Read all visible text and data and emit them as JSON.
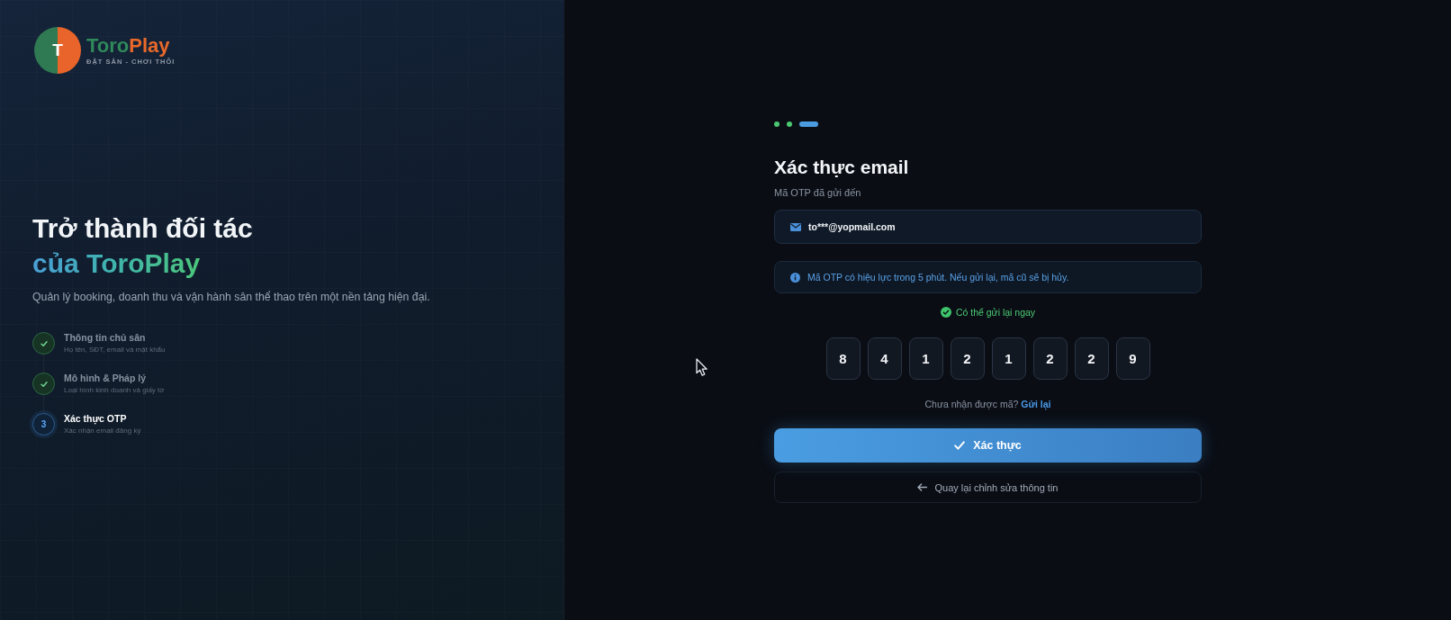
{
  "brand": {
    "logo_letter": "T",
    "name_parts": [
      {
        "text": "Toro",
        "color": "#2f8a5a"
      },
      {
        "text": "Play",
        "color": "#e8692a"
      }
    ],
    "tagline": "ĐẶT SÂN - CHƠI THÔI"
  },
  "hero": {
    "title_line_1": "Trở thành đối tác",
    "title_line_2": "của ToroPlay",
    "subtitle": "Quản lý booking, doanh thu và vận hành sân thể thao trên một nền tảng hiện đại."
  },
  "steps": [
    {
      "title": "Thông tin chủ sân",
      "description": "Họ tên, SĐT, email và mật khẩu",
      "completed": true,
      "selected": false
    },
    {
      "title": "Mô hình & Pháp lý",
      "description": "Loại hình kinh doanh và giấy tờ",
      "completed": true,
      "selected": false
    },
    {
      "number": "3",
      "title": "Xác thực OTP",
      "description": "Xác nhận email đăng ký",
      "completed": false,
      "selected": true
    }
  ],
  "form": {
    "progress": [
      {
        "completed": true,
        "selected": false
      },
      {
        "completed": true,
        "selected": false
      },
      {
        "completed": false,
        "selected": true
      }
    ],
    "title": "Xác thực email",
    "subtitle": "Mã OTP đã gửi đến",
    "email": "to***@yopmail.com",
    "info_note": "Mã OTP có hiệu lực trong 5 phút. Nếu gửi lại, mã cũ sẽ bị hủy.",
    "resend_status": "Có thể gửi lại ngay",
    "otp_digits": [
      "8",
      "4",
      "1",
      "2",
      "1",
      "2",
      "2",
      "9"
    ],
    "resend_prompt": "Chưa nhận được mã?",
    "resend_link": "Gửi lại",
    "verify_button": "Xác thực",
    "back_button": "Quay lại chỉnh sửa thông tin"
  }
}
